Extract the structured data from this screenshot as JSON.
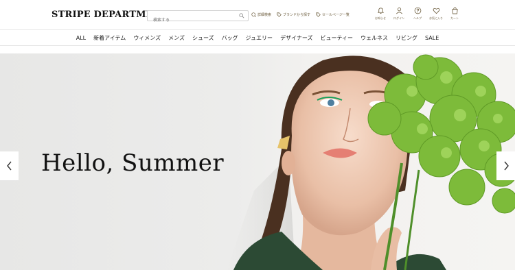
{
  "header": {
    "logo": "STRIPE DEPARTMENT",
    "search_placeholder": "検索する",
    "links": [
      {
        "label": "詳細検索",
        "icon": "search-detail-icon"
      },
      {
        "label": "ブランドから探す",
        "icon": "tag-icon"
      },
      {
        "label": "セールページ一覧",
        "icon": "tag-icon"
      }
    ],
    "icons": [
      {
        "label": "お知らせ",
        "icon": "bell-icon"
      },
      {
        "label": "ログイン",
        "icon": "user-icon"
      },
      {
        "label": "ヘルプ",
        "icon": "help-icon"
      },
      {
        "label": "お気に入り",
        "icon": "heart-icon"
      },
      {
        "label": "カート",
        "icon": "cart-icon"
      }
    ]
  },
  "nav": {
    "items": [
      "ALL",
      "新着アイテム",
      "ウィメンズ",
      "メンズ",
      "シューズ",
      "バッグ",
      "ジュエリー",
      "デザイナーズ",
      "ビューティー",
      "ウェルネス",
      "リビング",
      "SALE"
    ]
  },
  "hero": {
    "title": "Hello, Summer"
  },
  "colors": {
    "accent": "#6a5a3a",
    "leaf": "#7dbb3a",
    "background": "#ececeb"
  }
}
